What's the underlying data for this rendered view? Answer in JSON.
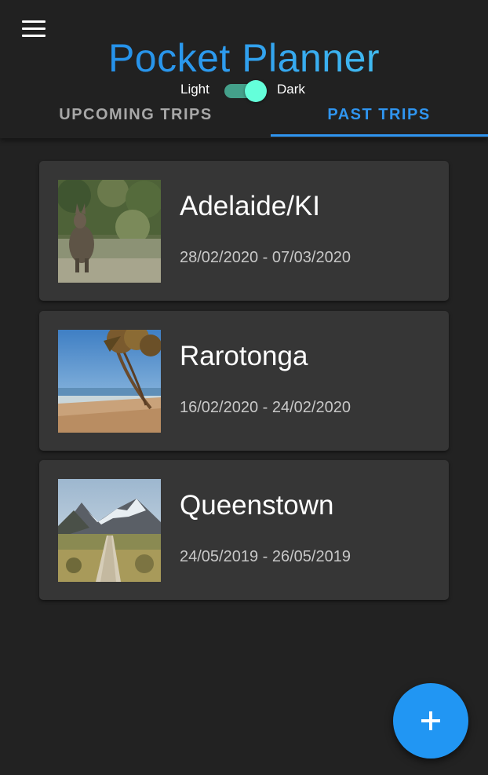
{
  "app": {
    "title": "Pocket Planner"
  },
  "header": {
    "menu_icon": "hamburger-menu-icon",
    "theme_toggle": {
      "light_label": "Light",
      "dark_label": "Dark",
      "value": "Dark"
    }
  },
  "tabs": [
    {
      "label": "UPCOMING TRIPS",
      "active": false
    },
    {
      "label": "PAST TRIPS",
      "active": true
    }
  ],
  "trips": [
    {
      "name": "Adelaide/KI",
      "dates": "28/02/2020 - 07/03/2020",
      "image": "wallaby-photo"
    },
    {
      "name": "Rarotonga",
      "dates": "16/02/2020 - 24/02/2020",
      "image": "beach-palm-photo"
    },
    {
      "name": "Queenstown",
      "dates": "24/05/2019 - 26/05/2019",
      "image": "mountain-boardwalk-photo"
    }
  ],
  "fab": {
    "icon": "plus-icon"
  },
  "colors": {
    "background": "#222222",
    "card": "#363636",
    "accent": "#2196f3",
    "toggle_thumb": "#64ffda"
  }
}
